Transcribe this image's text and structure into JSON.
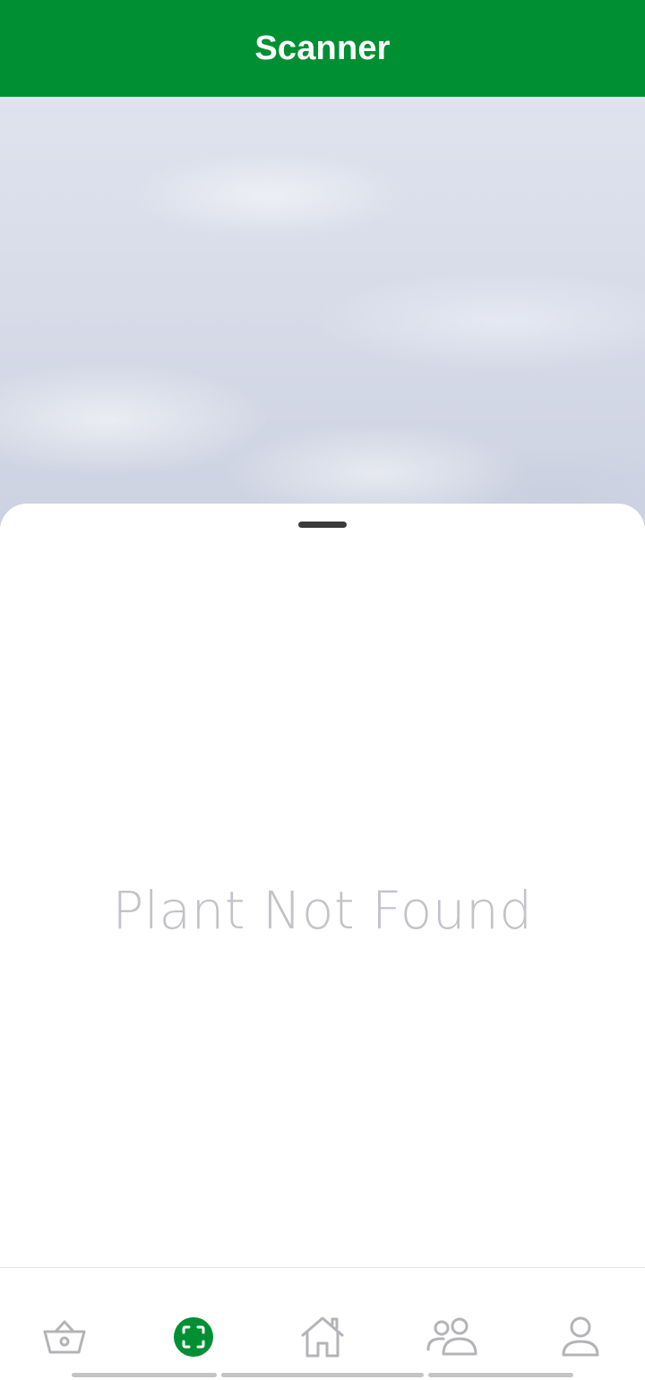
{
  "header": {
    "title": "Scanner"
  },
  "camera": {
    "state": "live-preview"
  },
  "sheet": {
    "message": "Plant Not Found"
  },
  "bottom_nav": {
    "active": "scanner",
    "items": [
      {
        "id": "shop",
        "icon": "basket-icon",
        "active": false
      },
      {
        "id": "scanner",
        "icon": "scan-icon",
        "active": true
      },
      {
        "id": "home",
        "icon": "home-icon",
        "active": false
      },
      {
        "id": "community",
        "icon": "people-icon",
        "active": false
      },
      {
        "id": "profile",
        "icon": "user-icon",
        "active": false
      }
    ]
  },
  "colors": {
    "brand_green": "#008f33",
    "icon_inactive": "#b4b4b8",
    "message_gray": "#c2c2c8"
  }
}
